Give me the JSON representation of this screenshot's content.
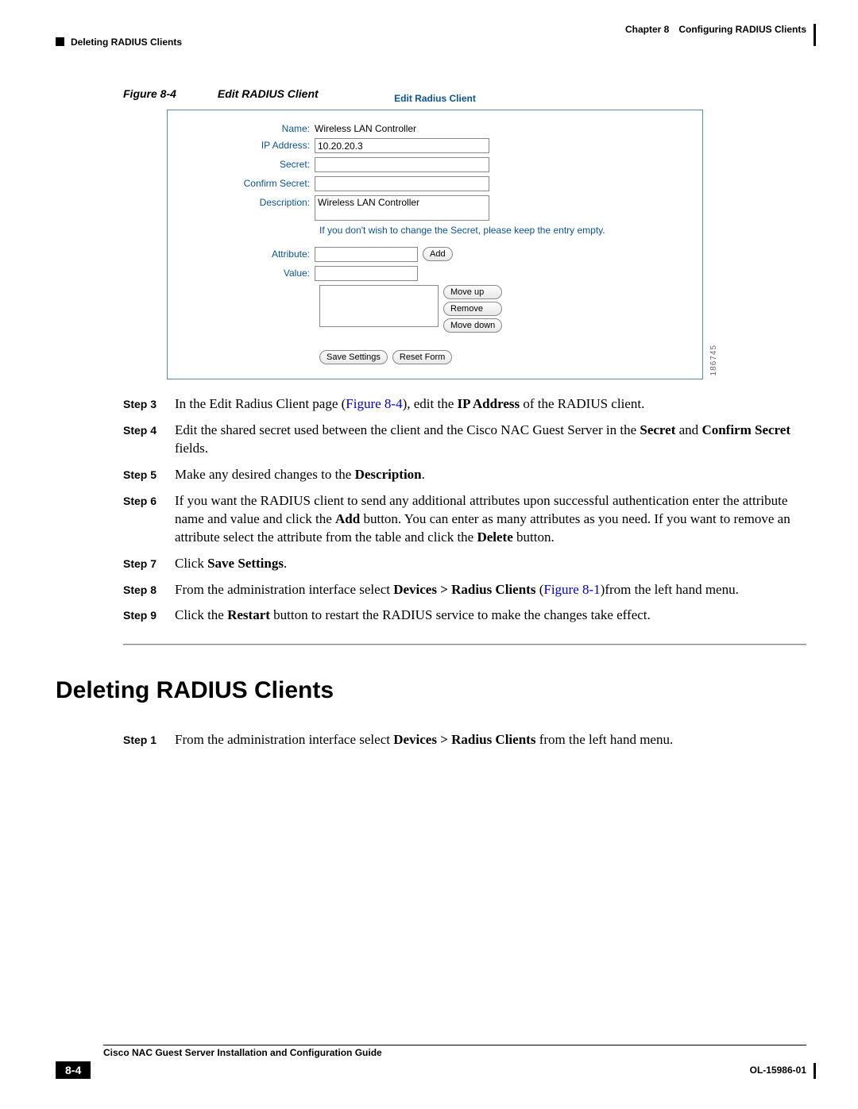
{
  "header": {
    "chapter": "Chapter 8",
    "title": "Configuring RADIUS Clients",
    "subheader": "Deleting RADIUS Clients"
  },
  "figure": {
    "caption_label": "Figure 8-4",
    "caption_title": "Edit RADIUS Client",
    "legend": "Edit Radius Client",
    "side_number": "186745",
    "labels": {
      "name": "Name:",
      "ip": "IP Address:",
      "secret": "Secret:",
      "confirm": "Confirm Secret:",
      "description": "Description:",
      "attribute": "Attribute:",
      "value": "Value:"
    },
    "values": {
      "name": "Wireless LAN Controller",
      "ip": "10.20.20.3",
      "description": "Wireless LAN Controller"
    },
    "hint": "If you don't wish to change the Secret, please keep the entry empty.",
    "buttons": {
      "add": "Add",
      "move_up": "Move up",
      "remove": "Remove",
      "move_down": "Move down",
      "save": "Save Settings",
      "reset": "Reset Form"
    }
  },
  "steps_a": [
    {
      "n": "Step 3",
      "t": "In the Edit Radius Client page (",
      "ref": "Figure 8-4",
      "t2": "), edit the ",
      "b1": "IP Address",
      "t3": " of the RADIUS client."
    },
    {
      "n": "Step 4",
      "t": "Edit the shared secret used between the client and the Cisco NAC Guest Server in the ",
      "b1": "Secret",
      "t2": " and ",
      "b2": "Confirm Secret",
      "t3": " fields."
    },
    {
      "n": "Step 5",
      "t": "Make any desired changes to the ",
      "b1": "Description",
      "t2": "."
    },
    {
      "n": "Step 6",
      "t": "If you want the RADIUS client to send any additional attributes upon successful authentication enter the attribute name and value and click the ",
      "b1": "Add",
      "t2": " button. You can enter as many attributes as you need. If you want to remove an attribute select the attribute from the table and click the ",
      "b2": "Delete",
      "t3": " button."
    },
    {
      "n": "Step 7",
      "t": "Click ",
      "b1": "Save Settings",
      "t2": "."
    },
    {
      "n": "Step 8",
      "t": "From the administration interface select ",
      "b1": "Devices > Radius Clients",
      "t2": " (",
      "ref": "Figure 8-1",
      "t3": ")from the left hand menu."
    },
    {
      "n": "Step 9",
      "t": "Click the ",
      "b1": "Restart",
      "t2": " button to restart the RADIUS service to make the changes take effect."
    }
  ],
  "section_heading": "Deleting RADIUS Clients",
  "steps_b": [
    {
      "n": "Step 1",
      "t": "From the administration interface select ",
      "b1": "Devices > Radius Clients",
      "t2": " from the left hand menu."
    }
  ],
  "footer": {
    "guide": "Cisco NAC Guest Server Installation and Configuration Guide",
    "page": "8-4",
    "doc_id": "OL-15986-01"
  }
}
